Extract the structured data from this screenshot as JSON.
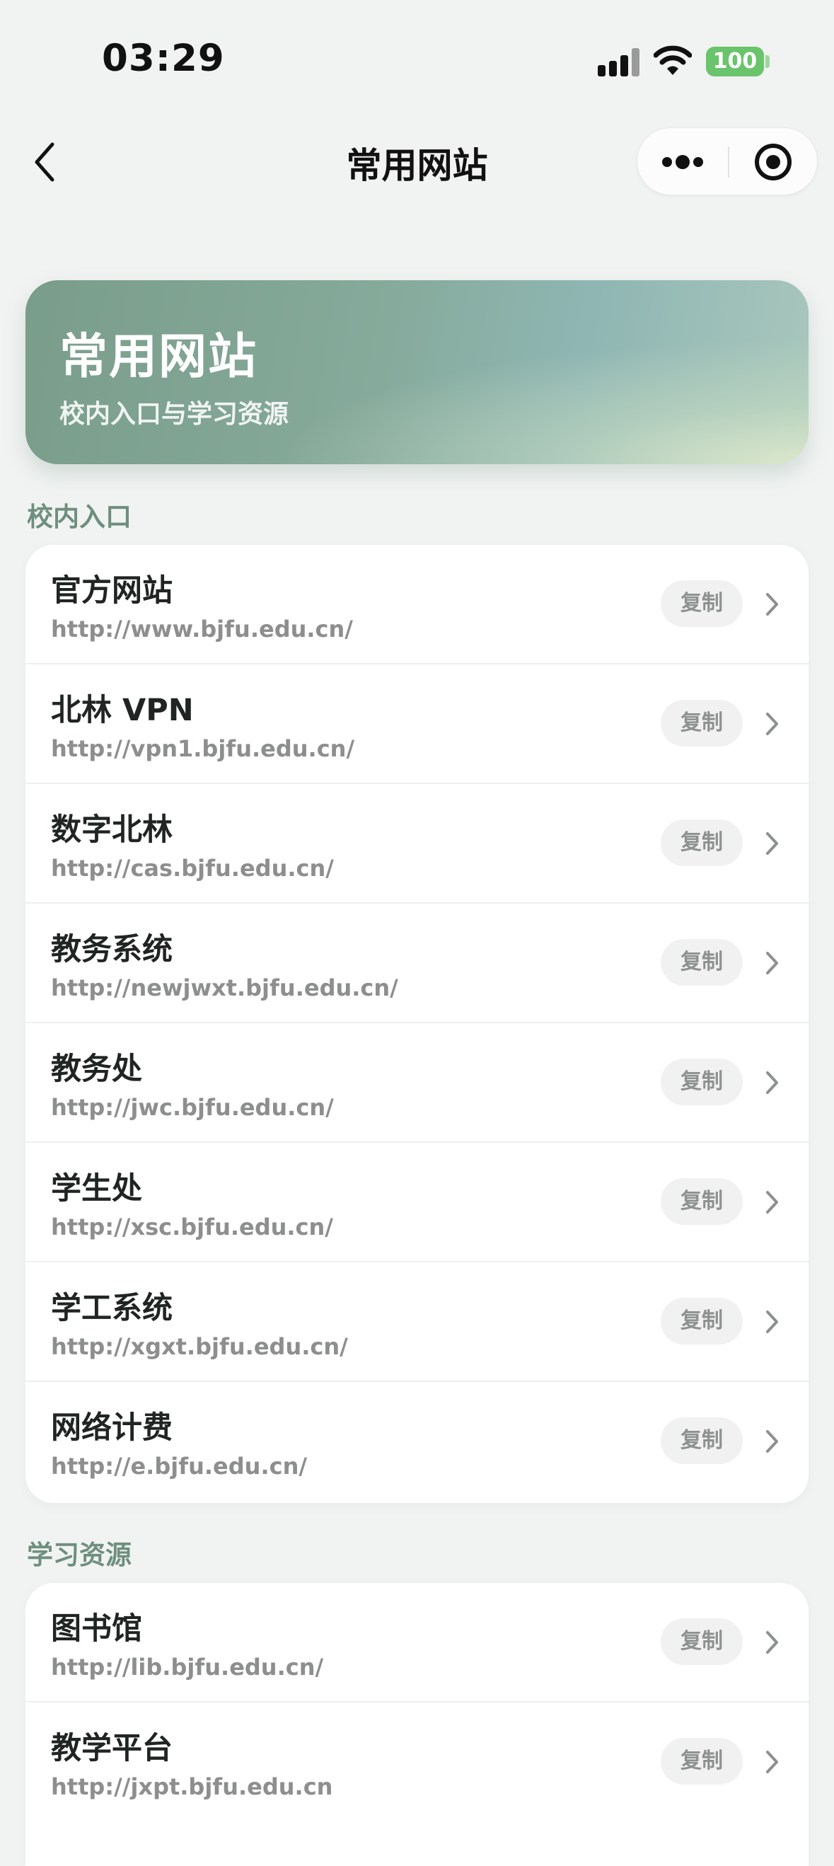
{
  "status_bar": {
    "time": "03:29",
    "battery": "100"
  },
  "nav": {
    "title": "常用网站"
  },
  "hero": {
    "title": "常用网站",
    "subtitle": "校内入口与学习资源"
  },
  "sections": [
    {
      "label": "校内入口",
      "items": [
        {
          "title": "官方网站",
          "url": "http://www.bjfu.edu.cn/",
          "copy_label": "复制"
        },
        {
          "title": "北林 VPN",
          "url": "http://vpn1.bjfu.edu.cn/",
          "copy_label": "复制"
        },
        {
          "title": "数字北林",
          "url": "http://cas.bjfu.edu.cn/",
          "copy_label": "复制"
        },
        {
          "title": "教务系统",
          "url": "http://newjwxt.bjfu.edu.cn/",
          "copy_label": "复制"
        },
        {
          "title": "教务处",
          "url": "http://jwc.bjfu.edu.cn/",
          "copy_label": "复制"
        },
        {
          "title": "学生处",
          "url": "http://xsc.bjfu.edu.cn/",
          "copy_label": "复制"
        },
        {
          "title": "学工系统",
          "url": "http://xgxt.bjfu.edu.cn/",
          "copy_label": "复制"
        },
        {
          "title": "网络计费",
          "url": "http://e.bjfu.edu.cn/",
          "copy_label": "复制"
        }
      ]
    },
    {
      "label": "学习资源",
      "items": [
        {
          "title": "图书馆",
          "url": "http://lib.bjfu.edu.cn/",
          "copy_label": "复制"
        },
        {
          "title": "教学平台",
          "url": "http://jxpt.bjfu.edu.cn",
          "copy_label": "复制"
        }
      ]
    }
  ],
  "icons": {
    "back": "chevron-left-icon",
    "more": "more-dots-icon",
    "close": "target-circle-icon",
    "row_arrow": "chevron-right-icon",
    "signal": "cellular-signal-icon",
    "wifi": "wifi-icon",
    "battery": "battery-icon"
  },
  "colors": {
    "section_label": "#6f8f7e",
    "hero_start": "#7a9d8b",
    "hero_end": "#dee9cd",
    "battery": "#6ac46b"
  }
}
